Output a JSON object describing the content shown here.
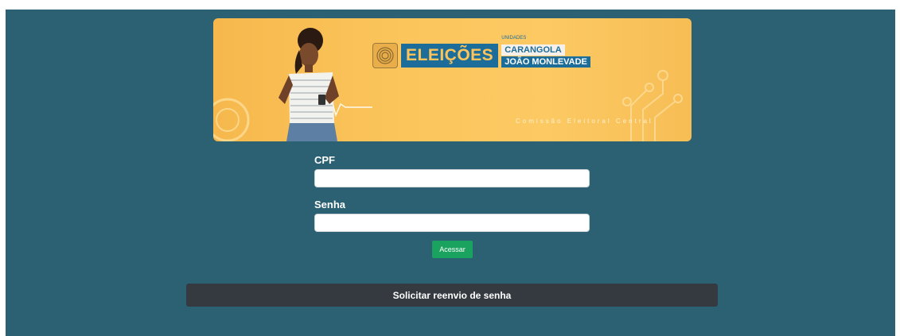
{
  "banner": {
    "logo_word": "ELEIÇÕES",
    "units_label": "UNIDADES",
    "unit_1": "CARANGOLA",
    "unit_2": "JOÃO MONLEVADE",
    "subtitle": "Comissão Eleitoral Central"
  },
  "form": {
    "cpf_label": "CPF",
    "cpf_value": "",
    "senha_label": "Senha",
    "senha_value": "",
    "submit_label": "Acessar"
  },
  "resend_button_label": "Solicitar reenvio de senha",
  "colors": {
    "page_background": "#2c6173",
    "banner_yellow": "#fcc963",
    "logo_blue": "#1d6d9a",
    "submit_green": "#1aa35f",
    "resend_dark": "#343a40"
  }
}
